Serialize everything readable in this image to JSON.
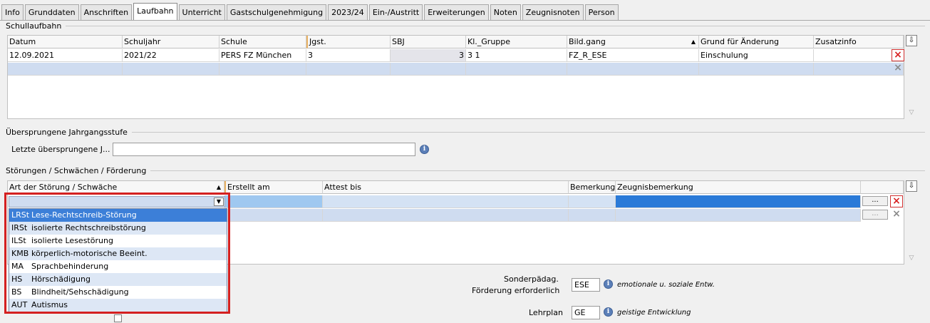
{
  "tabs": [
    "Info",
    "Grunddaten",
    "Anschriften",
    "Laufbahn",
    "Unterricht",
    "Gastschulgenehmigung",
    "2023/24",
    "Ein-/Austritt",
    "Erweiterungen",
    "Noten",
    "Zeugnisnoten",
    "Person"
  ],
  "active_tab": "Laufbahn",
  "schullaufbahn": {
    "title": "Schullaufbahn",
    "headers": [
      "Datum",
      "Schuljahr",
      "Schule",
      "Jgst.",
      "SBJ",
      "Kl._Gruppe",
      "Bild.gang",
      "Grund für Änderung",
      "Zusatzinfo"
    ],
    "row": {
      "datum": "12.09.2021",
      "schuljahr": "2021/22",
      "schule": "PERS FZ München",
      "jgst": "3",
      "sbj": "3",
      "kl_gruppe": "3 1",
      "bildgang": "FZ_R_ESE",
      "grund": "Einschulung",
      "zusatz": ""
    }
  },
  "uebersprungen": {
    "title": "Übersprungene Jahrgangsstufe",
    "label": "Letzte übersprungene J...",
    "value": ""
  },
  "stoerungen": {
    "title": "Störungen / Schwächen / Förderung",
    "headers": [
      "Art der Störung / Schwäche",
      "Erstellt am",
      "Attest bis",
      "Bemerkung",
      "Zeugnisbemerkung"
    ],
    "dots": "...",
    "options": [
      {
        "code": "LRSt",
        "label": "Lese-Rechtschreib-Störung"
      },
      {
        "code": "IRSt",
        "label": "isolierte Rechtschreibstörung"
      },
      {
        "code": "ILSt",
        "label": "isolierte Lesestörung"
      },
      {
        "code": "KMB",
        "label": "körperlich-motorische Beeint."
      },
      {
        "code": "MA",
        "label": "Sprachbehinderung"
      },
      {
        "code": "HS",
        "label": "Hörschädigung"
      },
      {
        "code": "BS",
        "label": "Blindheit/Sehschädigung"
      },
      {
        "code": "AUT",
        "label": "Autismus"
      }
    ]
  },
  "foerderung": {
    "label_line1": "Sonderpädag.",
    "label_line2": "Förderung erforderlich",
    "value": "ESE",
    "desc": "emotionale u. soziale Entw."
  },
  "lehrplan": {
    "label": "Lehrplan",
    "value": "GE",
    "desc": "geistige Entwicklung"
  },
  "icons": {
    "delete": "×",
    "info": "i",
    "dropdown": "▼",
    "export": "⇩"
  }
}
